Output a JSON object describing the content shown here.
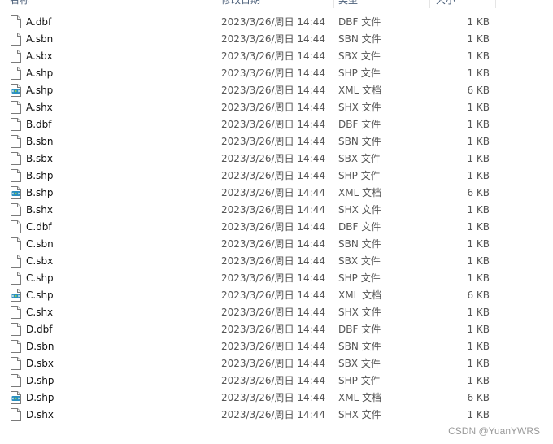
{
  "columns": {
    "name": "名称",
    "date": "修改日期",
    "type": "类型",
    "size": "大小"
  },
  "rows": [
    {
      "name": "A.dbf",
      "date": "2023/3/26/周日 14:44",
      "type": "DBF 文件",
      "size": "1 KB",
      "icon": "file-icon"
    },
    {
      "name": "A.sbn",
      "date": "2023/3/26/周日 14:44",
      "type": "SBN 文件",
      "size": "1 KB",
      "icon": "file-icon"
    },
    {
      "name": "A.sbx",
      "date": "2023/3/26/周日 14:44",
      "type": "SBX 文件",
      "size": "1 KB",
      "icon": "file-icon"
    },
    {
      "name": "A.shp",
      "date": "2023/3/26/周日 14:44",
      "type": "SHP 文件",
      "size": "1 KB",
      "icon": "file-icon"
    },
    {
      "name": "A.shp",
      "date": "2023/3/26/周日 14:44",
      "type": "XML 文档",
      "size": "6 KB",
      "icon": "xml-document-icon"
    },
    {
      "name": "A.shx",
      "date": "2023/3/26/周日 14:44",
      "type": "SHX 文件",
      "size": "1 KB",
      "icon": "file-icon"
    },
    {
      "name": "B.dbf",
      "date": "2023/3/26/周日 14:44",
      "type": "DBF 文件",
      "size": "1 KB",
      "icon": "file-icon"
    },
    {
      "name": "B.sbn",
      "date": "2023/3/26/周日 14:44",
      "type": "SBN 文件",
      "size": "1 KB",
      "icon": "file-icon"
    },
    {
      "name": "B.sbx",
      "date": "2023/3/26/周日 14:44",
      "type": "SBX 文件",
      "size": "1 KB",
      "icon": "file-icon"
    },
    {
      "name": "B.shp",
      "date": "2023/3/26/周日 14:44",
      "type": "SHP 文件",
      "size": "1 KB",
      "icon": "file-icon"
    },
    {
      "name": "B.shp",
      "date": "2023/3/26/周日 14:44",
      "type": "XML 文档",
      "size": "6 KB",
      "icon": "xml-document-icon"
    },
    {
      "name": "B.shx",
      "date": "2023/3/26/周日 14:44",
      "type": "SHX 文件",
      "size": "1 KB",
      "icon": "file-icon"
    },
    {
      "name": "C.dbf",
      "date": "2023/3/26/周日 14:44",
      "type": "DBF 文件",
      "size": "1 KB",
      "icon": "file-icon"
    },
    {
      "name": "C.sbn",
      "date": "2023/3/26/周日 14:44",
      "type": "SBN 文件",
      "size": "1 KB",
      "icon": "file-icon"
    },
    {
      "name": "C.sbx",
      "date": "2023/3/26/周日 14:44",
      "type": "SBX 文件",
      "size": "1 KB",
      "icon": "file-icon"
    },
    {
      "name": "C.shp",
      "date": "2023/3/26/周日 14:44",
      "type": "SHP 文件",
      "size": "1 KB",
      "icon": "file-icon"
    },
    {
      "name": "C.shp",
      "date": "2023/3/26/周日 14:44",
      "type": "XML 文档",
      "size": "6 KB",
      "icon": "xml-document-icon"
    },
    {
      "name": "C.shx",
      "date": "2023/3/26/周日 14:44",
      "type": "SHX 文件",
      "size": "1 KB",
      "icon": "file-icon"
    },
    {
      "name": "D.dbf",
      "date": "2023/3/26/周日 14:44",
      "type": "DBF 文件",
      "size": "1 KB",
      "icon": "file-icon"
    },
    {
      "name": "D.sbn",
      "date": "2023/3/26/周日 14:44",
      "type": "SBN 文件",
      "size": "1 KB",
      "icon": "file-icon"
    },
    {
      "name": "D.sbx",
      "date": "2023/3/26/周日 14:44",
      "type": "SBX 文件",
      "size": "1 KB",
      "icon": "file-icon"
    },
    {
      "name": "D.shp",
      "date": "2023/3/26/周日 14:44",
      "type": "SHP 文件",
      "size": "1 KB",
      "icon": "file-icon"
    },
    {
      "name": "D.shp",
      "date": "2023/3/26/周日 14:44",
      "type": "XML 文档",
      "size": "6 KB",
      "icon": "xml-document-icon"
    },
    {
      "name": "D.shx",
      "date": "2023/3/26/周日 14:44",
      "type": "SHX 文件",
      "size": "1 KB",
      "icon": "file-icon"
    }
  ],
  "watermark": "CSDN @YuanYWRS",
  "colors": {
    "header_text": "#4c607a",
    "xml_icon_accent": "#2a8fbf",
    "hover": "#e5f3ff"
  }
}
